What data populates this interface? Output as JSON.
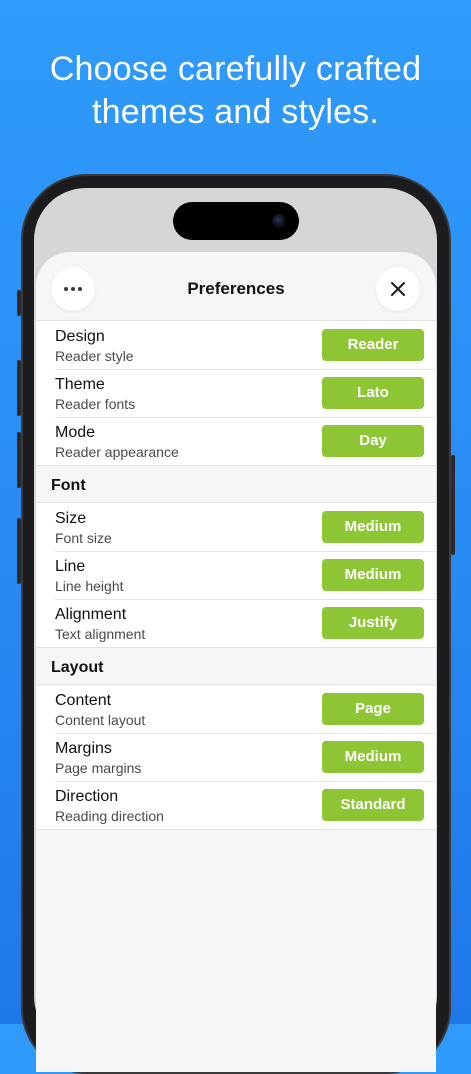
{
  "headline": {
    "line1": "Choose carefully crafted",
    "line2": "themes and styles."
  },
  "sheet": {
    "title": "Preferences",
    "more_icon": "ellipsis-icon",
    "close_icon": "close-icon"
  },
  "groups": [
    {
      "header": "",
      "rows": [
        {
          "title": "Design",
          "subtitle": "Reader style",
          "value": "Reader"
        },
        {
          "title": "Theme",
          "subtitle": "Reader fonts",
          "value": "Lato"
        },
        {
          "title": "Mode",
          "subtitle": "Reader appearance",
          "value": "Day"
        }
      ]
    },
    {
      "header": "Font",
      "rows": [
        {
          "title": "Size",
          "subtitle": "Font size",
          "value": "Medium"
        },
        {
          "title": "Line",
          "subtitle": "Line height",
          "value": "Medium"
        },
        {
          "title": "Alignment",
          "subtitle": "Text alignment",
          "value": "Justify"
        }
      ]
    },
    {
      "header": "Layout",
      "rows": [
        {
          "title": "Content",
          "subtitle": "Content layout",
          "value": "Page"
        },
        {
          "title": "Margins",
          "subtitle": "Page margins",
          "value": "Medium"
        },
        {
          "title": "Direction",
          "subtitle": "Reading direction",
          "value": "Standard"
        }
      ]
    }
  ],
  "colors": {
    "accent": "#8ec534",
    "background": "#2a8ef5"
  }
}
